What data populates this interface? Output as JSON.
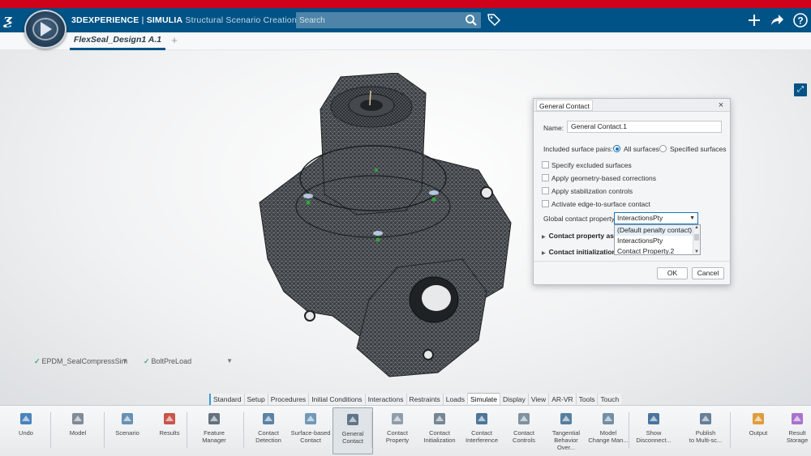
{
  "header": {
    "brand": "3DEXPERIENCE",
    "separator": " | ",
    "product": "SIMULIA",
    "app_name": " Structural Scenario Creation",
    "search_placeholder": "Search",
    "accent_color": "#005386",
    "strip_color": "#d0021b"
  },
  "tabs": {
    "document": "FlexSeal_Design1 A.1",
    "add": "+"
  },
  "viewport": {
    "material_selector": "EPDM_SealCompressSim",
    "load_selector": "BoltPreLoad"
  },
  "dialog": {
    "title": "General Contact",
    "close": "×",
    "name_label": "Name:",
    "name_value": "General Contact.1",
    "pairs_label": "Included surface pairs:",
    "radio_all": "All surfaces",
    "radio_specified": "Specified surfaces",
    "radio_selected": "All surfaces",
    "checkboxes": [
      "Specify excluded surfaces",
      "Apply geometry-based corrections",
      "Apply stabilization controls",
      "Activate edge-to-surface contact"
    ],
    "property_label": "Global contact property:",
    "property_value": "InteractionsPty",
    "dropdown_options": [
      "(Default penalty contact)",
      "InteractionsPty",
      "Contact Property.2"
    ],
    "section_1": "Contact property assig",
    "section_2": "Contact initialization a",
    "ok": "OK",
    "cancel": "Cancel"
  },
  "action_tabs": [
    "Standard",
    "Setup",
    "Procedures",
    "Initial Conditions",
    "Interactions",
    "Restraints",
    "Loads",
    "Simulate",
    "Display",
    "View",
    "AR-VR",
    "Tools",
    "Touch"
  ],
  "active_action_tab": "Simulate",
  "toolbar": [
    {
      "label": "Undo",
      "icon": "undo-icon"
    },
    {
      "label": "Model",
      "icon": "model-icon"
    },
    {
      "label": "Scenario",
      "icon": "scenario-icon"
    },
    {
      "label": "Results",
      "icon": "results-icon"
    },
    {
      "label": "Feature\nManager",
      "icon": "feature-manager-icon"
    },
    {
      "label": "Contact\nDetection",
      "icon": "contact-detection-icon"
    },
    {
      "label": "Surface-based\nContact",
      "icon": "surface-contact-icon"
    },
    {
      "label": "General\nContact",
      "icon": "general-contact-icon"
    },
    {
      "label": "Contact\nProperty",
      "icon": "contact-property-icon"
    },
    {
      "label": "Contact\nInitialization",
      "icon": "contact-init-icon"
    },
    {
      "label": "Contact\nInterference",
      "icon": "contact-interference-icon"
    },
    {
      "label": "Contact\nControls",
      "icon": "contact-controls-icon"
    },
    {
      "label": "Tangential\nBehavior Over...",
      "icon": "tangential-icon"
    },
    {
      "label": "Model\nChange Man...",
      "icon": "model-change-icon"
    },
    {
      "label": "Show\nDisconnect...",
      "icon": "show-disconnect-icon"
    },
    {
      "label": "Publish\nto Multi-sc...",
      "icon": "publish-icon"
    },
    {
      "label": "Output",
      "icon": "output-icon"
    },
    {
      "label": "Result\nStorage",
      "icon": "result-storage-icon"
    }
  ]
}
